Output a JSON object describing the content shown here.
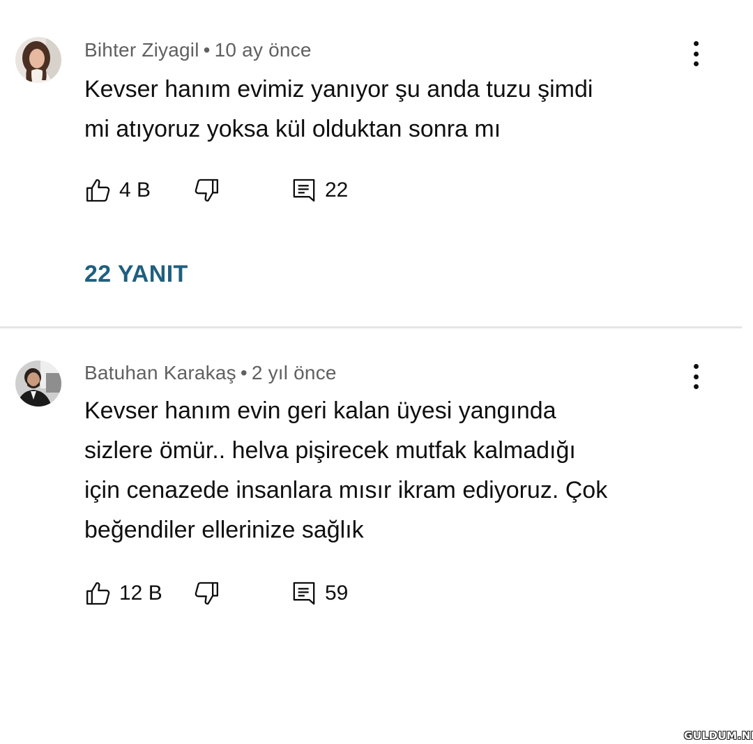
{
  "comments": [
    {
      "author": "Bihter Ziyagil",
      "separator": "•",
      "time": "10 ay önce",
      "text_lines": [
        "Kevser hanım evimiz yanıyor şu anda  tuzu şimdi",
        "mi atıyoruz yoksa kül olduktan sonra mı"
      ],
      "like_count": "4 B",
      "reply_count": "22",
      "replies_link": "22 YANIT",
      "icons": {
        "avatar": "user-avatar-woman",
        "like": "thumb-up-icon",
        "dislike": "thumb-down-icon",
        "reply": "reply-comment-icon",
        "menu": "more-vert-icon"
      }
    },
    {
      "author": "Batuhan Karakaş",
      "separator": "•",
      "time": "2 yıl önce",
      "text_lines": [
        "Kevser hanım evin geri kalan üyesi yangında",
        "sizlere ömür.. helva pişirecek mutfak kalmadığı",
        "için cenazede insanlara mısır ikram ediyoruz. Çok",
        "beğendiler ellerinize sağlık"
      ],
      "like_count": "12 B",
      "reply_count": "59",
      "icons": {
        "avatar": "user-avatar-man",
        "like": "thumb-up-icon",
        "dislike": "thumb-down-icon",
        "reply": "reply-comment-icon",
        "menu": "more-vert-icon"
      }
    }
  ],
  "watermark": "GULDUM.NET",
  "colors": {
    "meta_text": "#606060",
    "body_text": "#0f0f0f",
    "replies_link": "#1f5f7f",
    "divider": "#e5e5e5",
    "background": "#ffffff"
  }
}
